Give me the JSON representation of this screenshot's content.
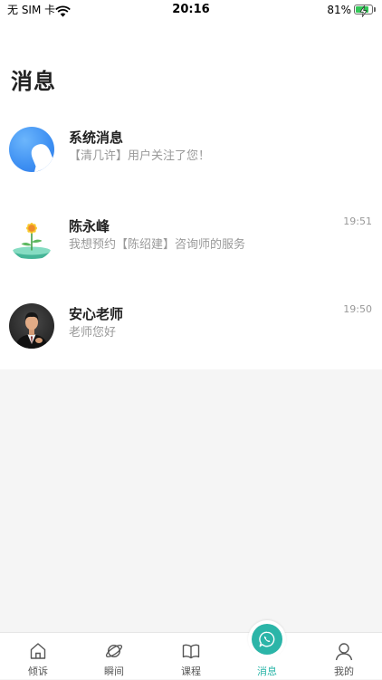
{
  "status_bar": {
    "carrier": "无 SIM 卡",
    "time": "20:16",
    "battery_text": "81%",
    "battery_level": 81,
    "wifi_icon": "wifi-icon",
    "battery_icon": "battery-charging-icon"
  },
  "header": {
    "title": "消息"
  },
  "messages": [
    {
      "name": "系统消息",
      "preview": "【清几许】用户关注了您！",
      "avatar_icon": "bell-icon"
    },
    {
      "name": "陈永峰",
      "preview": "我想预约【陈绍建】咨询师的服务",
      "time": "19:51"
    },
    {
      "name": "安心老师",
      "preview": "老师您好",
      "time": "19:50"
    }
  ],
  "tabbar": {
    "tabs": [
      {
        "label": "倾诉",
        "icon": "house-icon",
        "active": false
      },
      {
        "label": "瞬间",
        "icon": "planet-icon",
        "active": false
      },
      {
        "label": "课程",
        "icon": "book-icon",
        "active": false
      },
      {
        "label": "消息",
        "icon": "chat-icon",
        "active": true
      },
      {
        "label": "我的",
        "icon": "person-icon",
        "active": false
      }
    ]
  },
  "colors": {
    "accent": "#2bb5a8",
    "system_avatar": "#3d8ff2",
    "battery": "#34c759",
    "text_secondary": "#999999"
  }
}
